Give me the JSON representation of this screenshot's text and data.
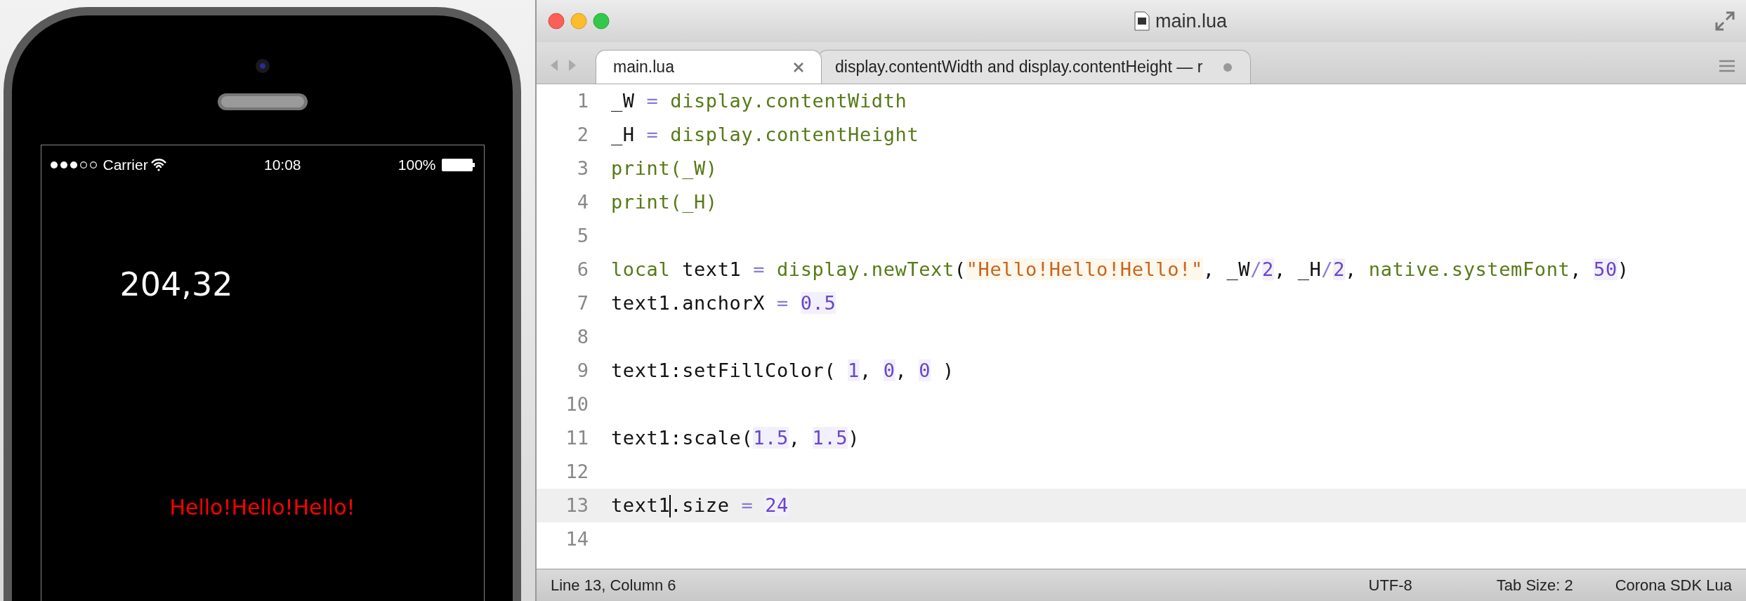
{
  "phone": {
    "status_bar": {
      "carrier": "Carrier",
      "time": "10:08",
      "battery": "100%"
    },
    "screen_texts": [
      {
        "text": "204,32",
        "kind": "readout"
      },
      {
        "text": "Hello!Hello!Hello!",
        "kind": "display_text"
      }
    ]
  },
  "editor": {
    "window": {
      "title": "main.lua"
    },
    "tabs": [
      {
        "label": "main.lua",
        "selected": true,
        "modified": false
      },
      {
        "label": "display.contentWidth and display.contentHeight — r",
        "selected": false,
        "modified": true
      }
    ],
    "code_lines": [
      {
        "number": "1",
        "current": false,
        "tokens": [
          {
            "text": "_W ",
            "kind": "plain"
          },
          {
            "text": "=",
            "kind": "op"
          },
          {
            "text": " display.contentWidth",
            "kind": "func"
          }
        ]
      },
      {
        "number": "2",
        "current": false,
        "tokens": [
          {
            "text": "_H ",
            "kind": "plain"
          },
          {
            "text": "=",
            "kind": "op"
          },
          {
            "text": " display.contentHeight",
            "kind": "func"
          }
        ]
      },
      {
        "number": "3",
        "current": false,
        "tokens": [
          {
            "text": "print(_W)",
            "kind": "func"
          }
        ]
      },
      {
        "number": "4",
        "current": false,
        "tokens": [
          {
            "text": "print(_H)",
            "kind": "func"
          }
        ]
      },
      {
        "number": "5",
        "current": false
      },
      {
        "number": "6",
        "current": false,
        "tokens": [
          {
            "text": "local",
            "kind": "func"
          },
          {
            "text": " text1 ",
            "kind": "plain"
          },
          {
            "text": "=",
            "kind": "op"
          },
          {
            "text": " display.newText",
            "kind": "func"
          },
          {
            "text": "(",
            "kind": "plain"
          },
          {
            "text": "\"Hello!Hello!Hello!\"",
            "kind": "str"
          },
          {
            "text": ", _W",
            "kind": "plain"
          },
          {
            "text": "/",
            "kind": "op"
          },
          {
            "text": "2",
            "kind": "num"
          },
          {
            "text": ", _H",
            "kind": "plain"
          },
          {
            "text": "/",
            "kind": "op"
          },
          {
            "text": "2",
            "kind": "num"
          },
          {
            "text": ", ",
            "kind": "plain"
          },
          {
            "text": "native.systemFont",
            "kind": "func"
          },
          {
            "text": ", ",
            "kind": "plain"
          },
          {
            "text": "50",
            "kind": "num"
          },
          {
            "text": ")",
            "kind": "plain"
          }
        ]
      },
      {
        "number": "7",
        "current": false,
        "tokens": [
          {
            "text": "text1.anchorX ",
            "kind": "plain"
          },
          {
            "text": "= ",
            "kind": "op"
          },
          {
            "text": "0.5",
            "kind": "num"
          }
        ]
      },
      {
        "number": "8",
        "current": false
      },
      {
        "number": "9",
        "current": false,
        "tokens": [
          {
            "text": "text1:setFillColor( ",
            "kind": "plain"
          },
          {
            "text": "1",
            "kind": "num"
          },
          {
            "text": ", ",
            "kind": "plain"
          },
          {
            "text": "0",
            "kind": "num"
          },
          {
            "text": ", ",
            "kind": "plain"
          },
          {
            "text": "0",
            "kind": "num"
          },
          {
            "text": " )",
            "kind": "plain"
          }
        ]
      },
      {
        "number": "10",
        "current": false
      },
      {
        "number": "11",
        "current": false,
        "tokens": [
          {
            "text": "text1:scale(",
            "kind": "plain"
          },
          {
            "text": "1.5",
            "kind": "num"
          },
          {
            "text": ", ",
            "kind": "plain"
          },
          {
            "text": "1.5",
            "kind": "num"
          },
          {
            "text": ")",
            "kind": "plain"
          }
        ]
      },
      {
        "number": "12",
        "current": false
      },
      {
        "number": "13",
        "current": true,
        "tokens": [
          {
            "text": "text1",
            "kind": "plain"
          },
          {
            "kind": "caret"
          },
          {
            "text": ".size ",
            "kind": "plain"
          },
          {
            "text": "= ",
            "kind": "op"
          },
          {
            "text": "24",
            "kind": "num"
          }
        ]
      },
      {
        "number": "14",
        "current": false
      }
    ],
    "status_bar": {
      "position": "Line 13, Column 6",
      "encoding": "UTF-8",
      "tab_size": "Tab Size: 2",
      "syntax": "Corona SDK Lua"
    }
  }
}
